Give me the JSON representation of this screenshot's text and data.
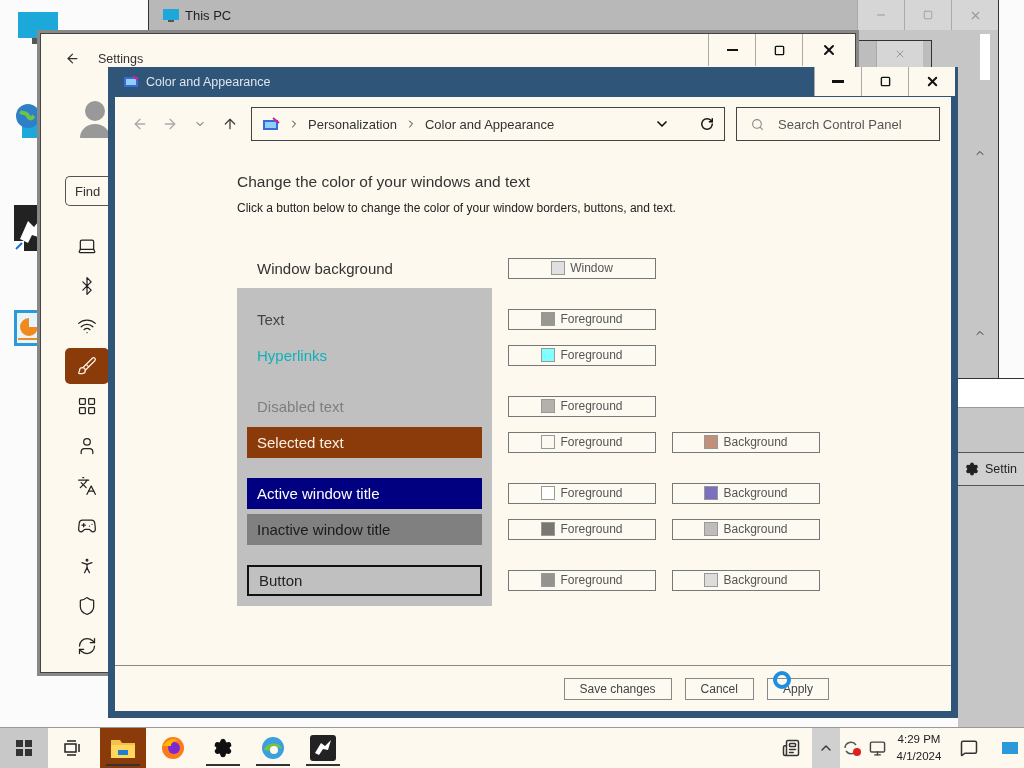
{
  "desktop_windows": {
    "this_pc": {
      "title": "This PC"
    },
    "settings": {
      "title": "Settings",
      "search": {
        "placeholder": "Find"
      },
      "nav": [
        {
          "kind": "system",
          "selected": false
        },
        {
          "kind": "bluetooth",
          "selected": false
        },
        {
          "kind": "network",
          "selected": false
        },
        {
          "kind": "personalization",
          "selected": true
        },
        {
          "kind": "apps",
          "selected": false
        },
        {
          "kind": "accounts",
          "selected": false
        },
        {
          "kind": "time",
          "selected": false
        },
        {
          "kind": "gaming",
          "selected": false
        },
        {
          "kind": "accessibility",
          "selected": false
        },
        {
          "kind": "privacy",
          "selected": false
        },
        {
          "kind": "update",
          "selected": false
        }
      ]
    },
    "side_window": {
      "item": "Settin"
    }
  },
  "window": {
    "title": "Color and Appearance"
  },
  "address_bar": {
    "crumbs": [
      "Personalization",
      "Color and Appearance"
    ]
  },
  "search": {
    "placeholder": "Search Control Panel"
  },
  "heading": "Change the color of your windows and text",
  "instruction": "Click a button below to change the color of your window borders, buttons, and text.",
  "window_background": {
    "kind": "window_background",
    "label": "Window background",
    "buttons": [
      {
        "label": "Window",
        "color": "#e0e0e0"
      }
    ]
  },
  "preview_groups": [
    {
      "items": [
        {
          "kind": "text",
          "label": "Text",
          "buttons": [
            {
              "label": "Foreground",
              "color": "#9a9690"
            }
          ]
        },
        {
          "kind": "hyperlink",
          "label": "Hyperlinks",
          "buttons": [
            {
              "label": "Foreground",
              "color": "#80ffff"
            }
          ]
        }
      ]
    },
    {
      "items": [
        {
          "kind": "disabled",
          "label": "Disabled text",
          "buttons": [
            {
              "label": "Foreground",
              "color": "#b4b0ac"
            }
          ]
        },
        {
          "kind": "selected",
          "label": "Selected text",
          "buttons": [
            {
              "label": "Foreground",
              "color": "#fdf8f0"
            },
            {
              "label": "Background",
              "color": "#c09078"
            }
          ]
        }
      ]
    },
    {
      "items": [
        {
          "kind": "active_title",
          "label": "Active window title",
          "buttons": [
            {
              "label": "Foreground",
              "color": "#ffffff"
            },
            {
              "label": "Background",
              "color": "#7a70c0"
            }
          ]
        },
        {
          "kind": "inactive_title",
          "label": "Inactive window title",
          "buttons": [
            {
              "label": "Foreground",
              "color": "#7a7670"
            },
            {
              "label": "Background",
              "color": "#c0bcbc"
            }
          ]
        }
      ]
    },
    {
      "items": [
        {
          "kind": "button",
          "label": "Button",
          "buttons": [
            {
              "label": "Foreground",
              "color": "#959390"
            },
            {
              "label": "Background",
              "color": "#dedcda"
            }
          ]
        }
      ]
    }
  ],
  "footer_buttons": [
    {
      "label": "Save changes",
      "disabled": false
    },
    {
      "label": "Cancel",
      "disabled": false
    },
    {
      "label": "Apply",
      "disabled": false
    }
  ],
  "taskbar": {
    "apps": [
      {
        "kind": "explorer",
        "selected": true,
        "running": true
      },
      {
        "kind": "firefox",
        "selected": false,
        "running": false
      },
      {
        "kind": "gear",
        "selected": false,
        "running": true
      },
      {
        "kind": "edge",
        "selected": false,
        "running": true
      },
      {
        "kind": "eagle",
        "selected": false,
        "running": true
      }
    ],
    "time": "4:29 PM",
    "date": "4/1/2024"
  }
}
